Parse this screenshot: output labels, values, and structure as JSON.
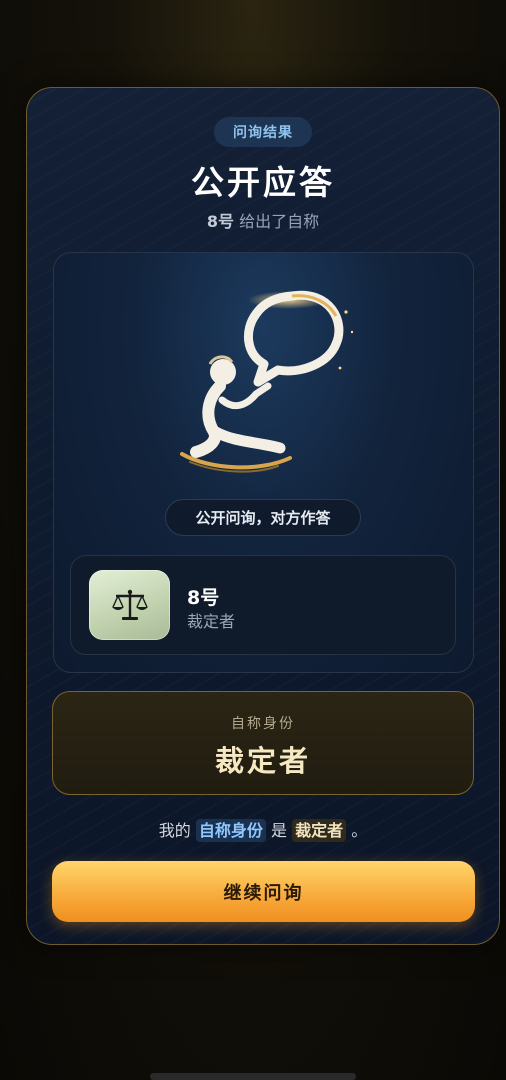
{
  "header": {
    "tag": "问询结果",
    "title": "公开应答",
    "subtitle_num": "8号",
    "subtitle_text": " 给出了自称"
  },
  "stage": {
    "caption": "公开问询，对方作答",
    "illustration_icon": "speaking-figure-icon"
  },
  "player": {
    "number": "8号",
    "role": "裁定者",
    "avatar_icon": "scales-icon"
  },
  "identity": {
    "label": "自称身份",
    "value": "裁定者"
  },
  "statement": {
    "prefix": "我的 ",
    "highlight1": "自称身份",
    "middle": " 是 ",
    "highlight2": "裁定者",
    "suffix": " 。"
  },
  "actions": {
    "continue_label": "继续问询"
  },
  "colors": {
    "accent_gold": "#f7a93a",
    "accent_blue": "#8fc4ee",
    "panel_bg": "#0e1a2e"
  }
}
